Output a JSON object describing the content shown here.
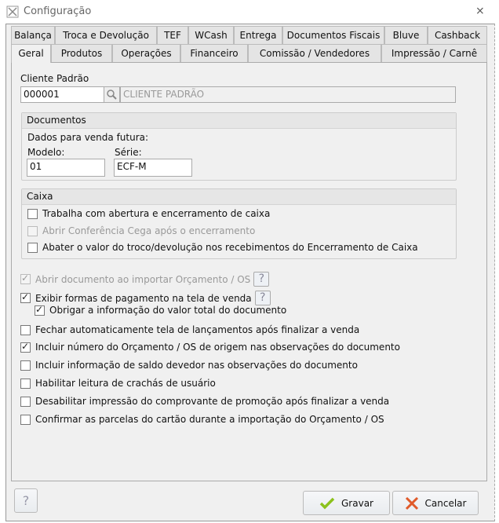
{
  "window": {
    "title": "Configuração",
    "close": "⨯"
  },
  "tabs_row1": [
    {
      "label": "Balança"
    },
    {
      "label": "Troca e Devolução"
    },
    {
      "label": "TEF"
    },
    {
      "label": "WCash"
    },
    {
      "label": "Entrega"
    },
    {
      "label": "Documentos Fiscais"
    },
    {
      "label": "Bluve"
    },
    {
      "label": "Cashback"
    }
  ],
  "tabs_row2": [
    {
      "label": "Geral"
    },
    {
      "label": "Produtos"
    },
    {
      "label": "Operações"
    },
    {
      "label": "Financeiro"
    },
    {
      "label": "Comissão / Vendedores"
    },
    {
      "label": "Impressão / Carnê"
    }
  ],
  "active_tab": "Geral",
  "cliente": {
    "label": "Cliente Padrão",
    "code": "000001",
    "name": "CLIENTE PADRÃO"
  },
  "documentos": {
    "title": "Documentos",
    "subtitle": "Dados para venda futura:",
    "modelo_label": "Modelo:",
    "modelo": "01",
    "serie_label": "Série:",
    "serie": "ECF-M"
  },
  "caixa": {
    "title": "Caixa",
    "options": [
      {
        "label": "Trabalha com abertura e encerramento de caixa",
        "checked": false,
        "disabled": false
      },
      {
        "label": "Abrir Conferência Cega após o encerramento",
        "checked": false,
        "disabled": true
      },
      {
        "label": "Abater o valor do troco/devolução nos recebimentos do Encerramento de Caixa",
        "checked": false,
        "disabled": false
      }
    ]
  },
  "options": [
    {
      "label": "Abrir documento ao importar Orçamento / OS",
      "checked": true,
      "disabled": true,
      "help": "?"
    },
    {
      "label": "Exibir formas de pagamento na tela de venda",
      "checked": true,
      "disabled": false,
      "help": "?"
    },
    {
      "label": "Obrigar a informação do valor total do documento",
      "checked": true,
      "disabled": false
    },
    {
      "label": "Fechar automaticamente tela de lançamentos após finalizar a venda",
      "checked": false,
      "disabled": false
    },
    {
      "label": "Incluir número do Orçamento / OS de origem nas observações do documento",
      "checked": true,
      "disabled": false
    },
    {
      "label": "Incluir informação de saldo devedor nas observações do documento",
      "checked": false,
      "disabled": false
    },
    {
      "label": "Habilitar leitura de crachás de usuário",
      "checked": false,
      "disabled": false
    },
    {
      "label": "Desabilitar impressão do comprovante de promoção após finalizar a venda",
      "checked": false,
      "disabled": false
    },
    {
      "label": "Confirmar as parcelas do cartão durante a importação do Orçamento / OS",
      "checked": false,
      "disabled": false
    }
  ],
  "footer": {
    "help": "?",
    "save": "Gravar",
    "cancel": "Cancelar"
  },
  "colors": {
    "save_icon": "#8cc21c",
    "cancel_icon": "#e05a2a"
  }
}
